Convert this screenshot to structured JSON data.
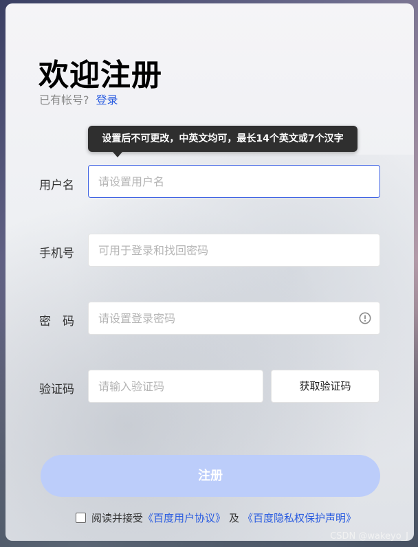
{
  "page": {
    "title": "欢迎注册",
    "have_account_text": "已有帐号?",
    "login_link": "登录"
  },
  "tooltip": {
    "text": "设置后不可更改，中英文均可，最长14个英文或7个汉字"
  },
  "form": {
    "username": {
      "label": "用户名",
      "placeholder": "请设置用户名",
      "value": ""
    },
    "phone": {
      "label": "手机号",
      "placeholder": "可用于登录和找回密码",
      "value": ""
    },
    "password": {
      "label": "密　码",
      "placeholder": "请设置登录密码",
      "value": "",
      "icon": "info-circle-icon"
    },
    "code": {
      "label": "验证码",
      "placeholder": "请输入验证码",
      "value": "",
      "get_code_label": "获取验证码"
    }
  },
  "submit": {
    "label": "注册"
  },
  "agreement": {
    "prefix": "阅读并接受",
    "user_agreement": "《百度用户协议》",
    "and": "及",
    "privacy": "《百度隐私权保护声明》",
    "checked": false
  },
  "watermark": "CSDN @wakeyo_J",
  "colors": {
    "accent": "#2a5ce0",
    "submit_bg": "#bccdfa",
    "tooltip_bg": "#2f2f2f"
  }
}
